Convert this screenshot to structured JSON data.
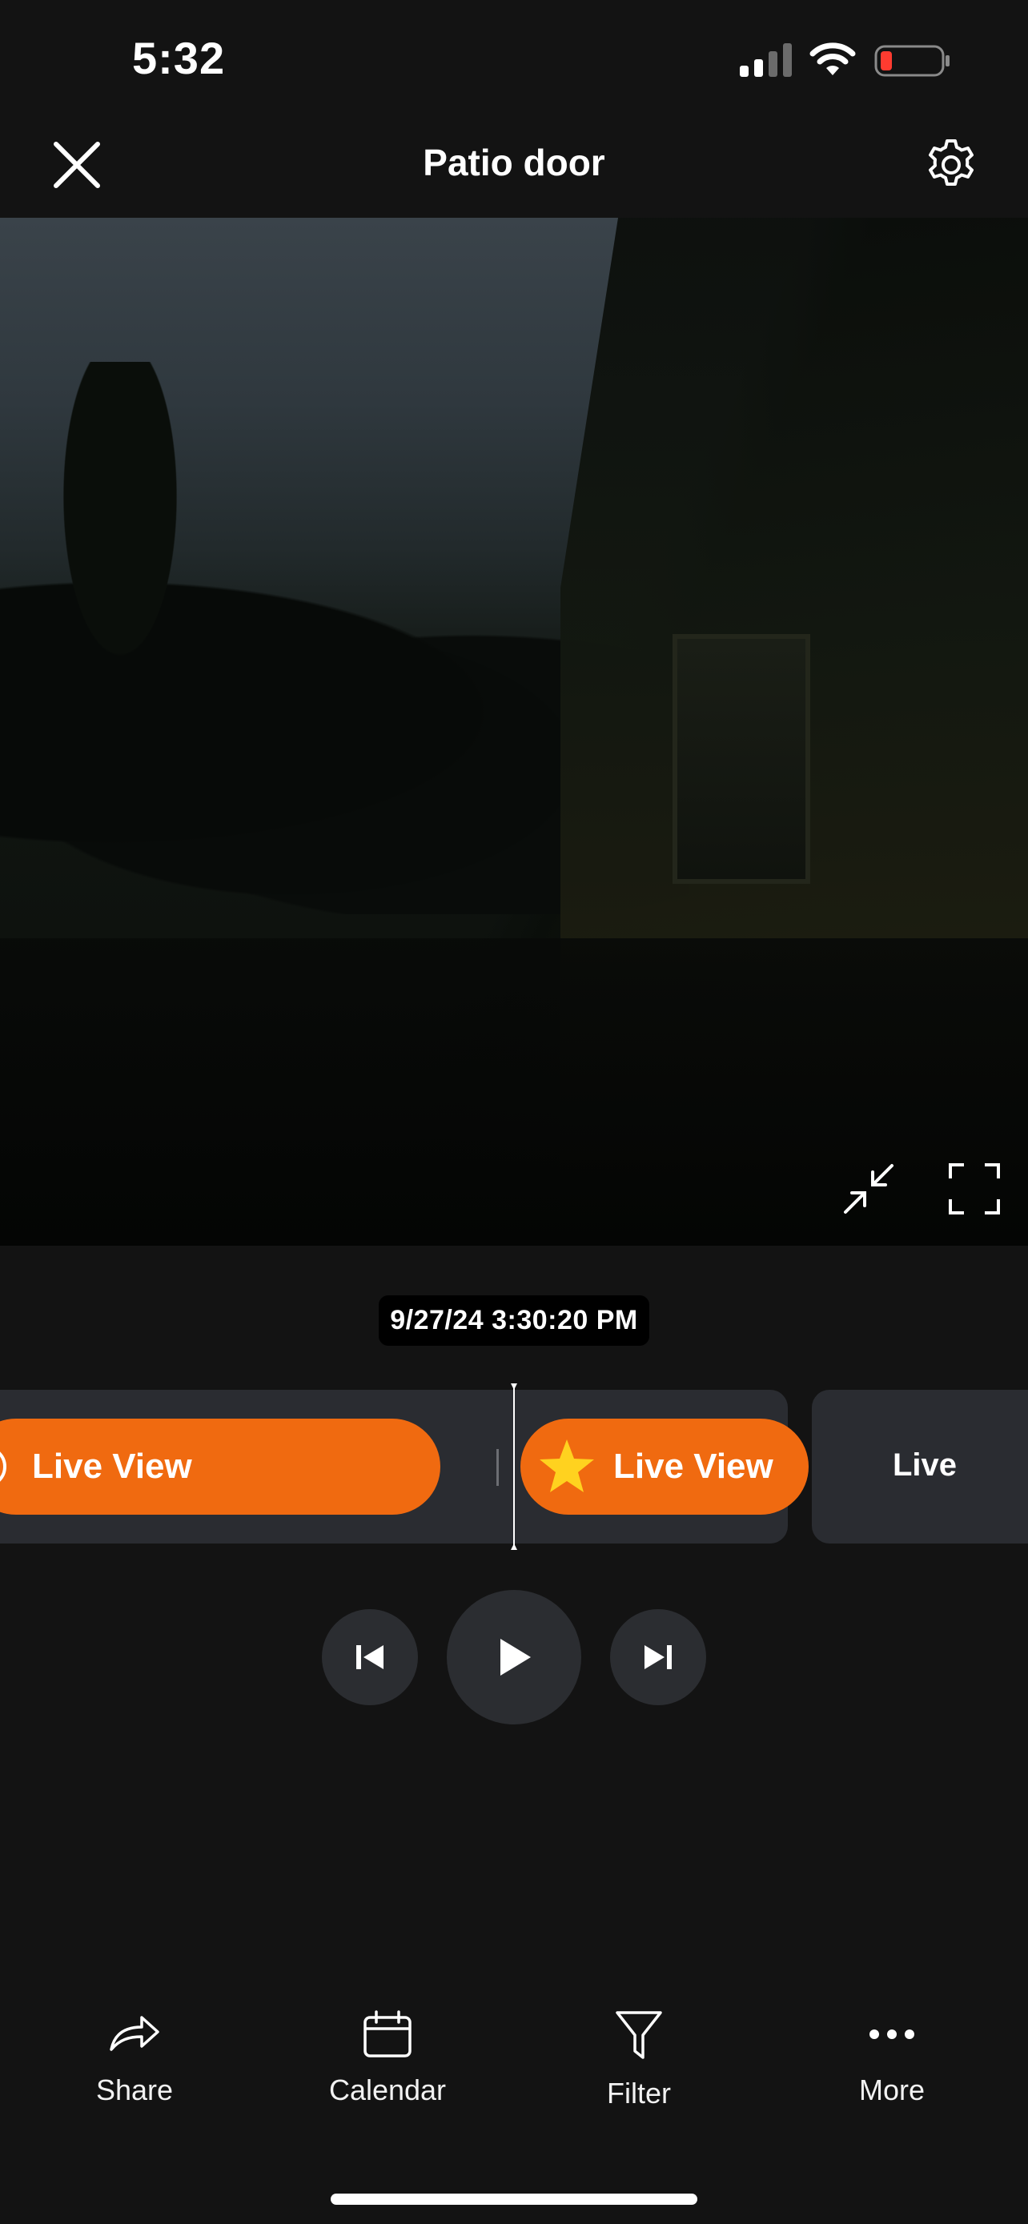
{
  "status_bar": {
    "time": "5:32",
    "battery_color": "#ff3b30"
  },
  "header": {
    "title": "Patio door",
    "close_icon": "close-icon",
    "settings_icon": "gear-icon"
  },
  "video": {
    "minimize_icon": "minimize-icon",
    "fullscreen_icon": "fullscreen-icon"
  },
  "timestamp": "9/27/24 3:30:20 PM",
  "timeline": {
    "events": [
      {
        "label": "Live View",
        "type": "motion"
      },
      {
        "label": "Live View",
        "type": "starred"
      },
      {
        "label": "Live",
        "type": "plain"
      }
    ],
    "accent": "#f06a10",
    "star_color": "#ffd21f"
  },
  "controls": {
    "prev_icon": "skip-previous-icon",
    "play_icon": "play-icon",
    "next_icon": "skip-next-icon"
  },
  "nav": {
    "items": [
      {
        "label": "Share",
        "icon": "share-icon"
      },
      {
        "label": "Calendar",
        "icon": "calendar-icon"
      },
      {
        "label": "Filter",
        "icon": "filter-icon"
      },
      {
        "label": "More",
        "icon": "more-icon"
      }
    ]
  }
}
